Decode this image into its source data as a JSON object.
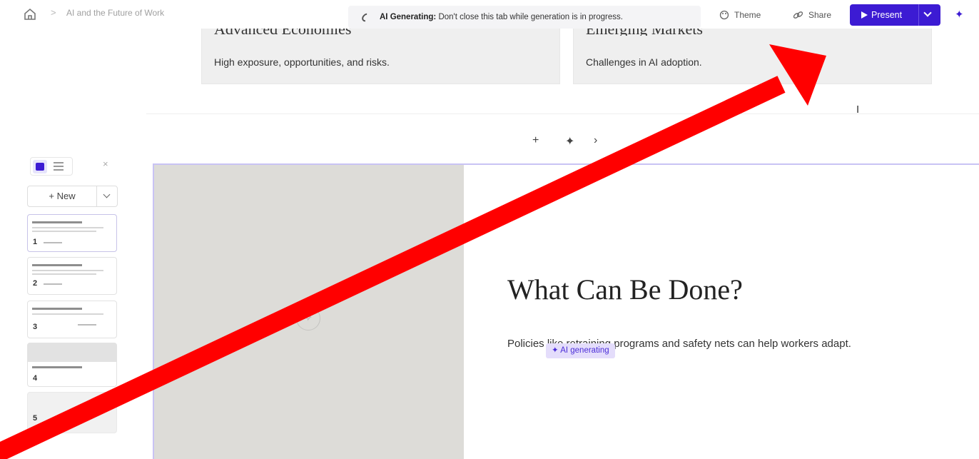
{
  "breadcrumb": {
    "home_icon": "home-icon",
    "separator": ">",
    "title": "AI and the Future of Work"
  },
  "generation_banner": {
    "label": "AI Generating:",
    "message": "Don't close this tab while generation is in progress."
  },
  "toolbar": {
    "theme_label": "Theme",
    "share_label": "Share",
    "present_label": "Present",
    "accent_color": "#3c1bd3"
  },
  "previous_card": {
    "boxes": [
      {
        "title": "Advanced Economies",
        "description": "High exposure, opportunities, and risks."
      },
      {
        "title": "Emerging Markets",
        "description": "Challenges in AI adoption."
      }
    ]
  },
  "card_toolbar": {
    "add": "+",
    "ai": "✦",
    "more": "›"
  },
  "sidebar": {
    "new_label": "+ New",
    "close": "×",
    "slides": [
      {
        "number": "1"
      },
      {
        "number": "2"
      },
      {
        "number": "3"
      },
      {
        "number": "4"
      },
      {
        "number": "5"
      }
    ]
  },
  "current_card": {
    "heading": "What Can Be Done?",
    "body": "Policies like retraining programs and safety nets can help workers adapt.",
    "ai_chip": "✦ AI generating"
  }
}
